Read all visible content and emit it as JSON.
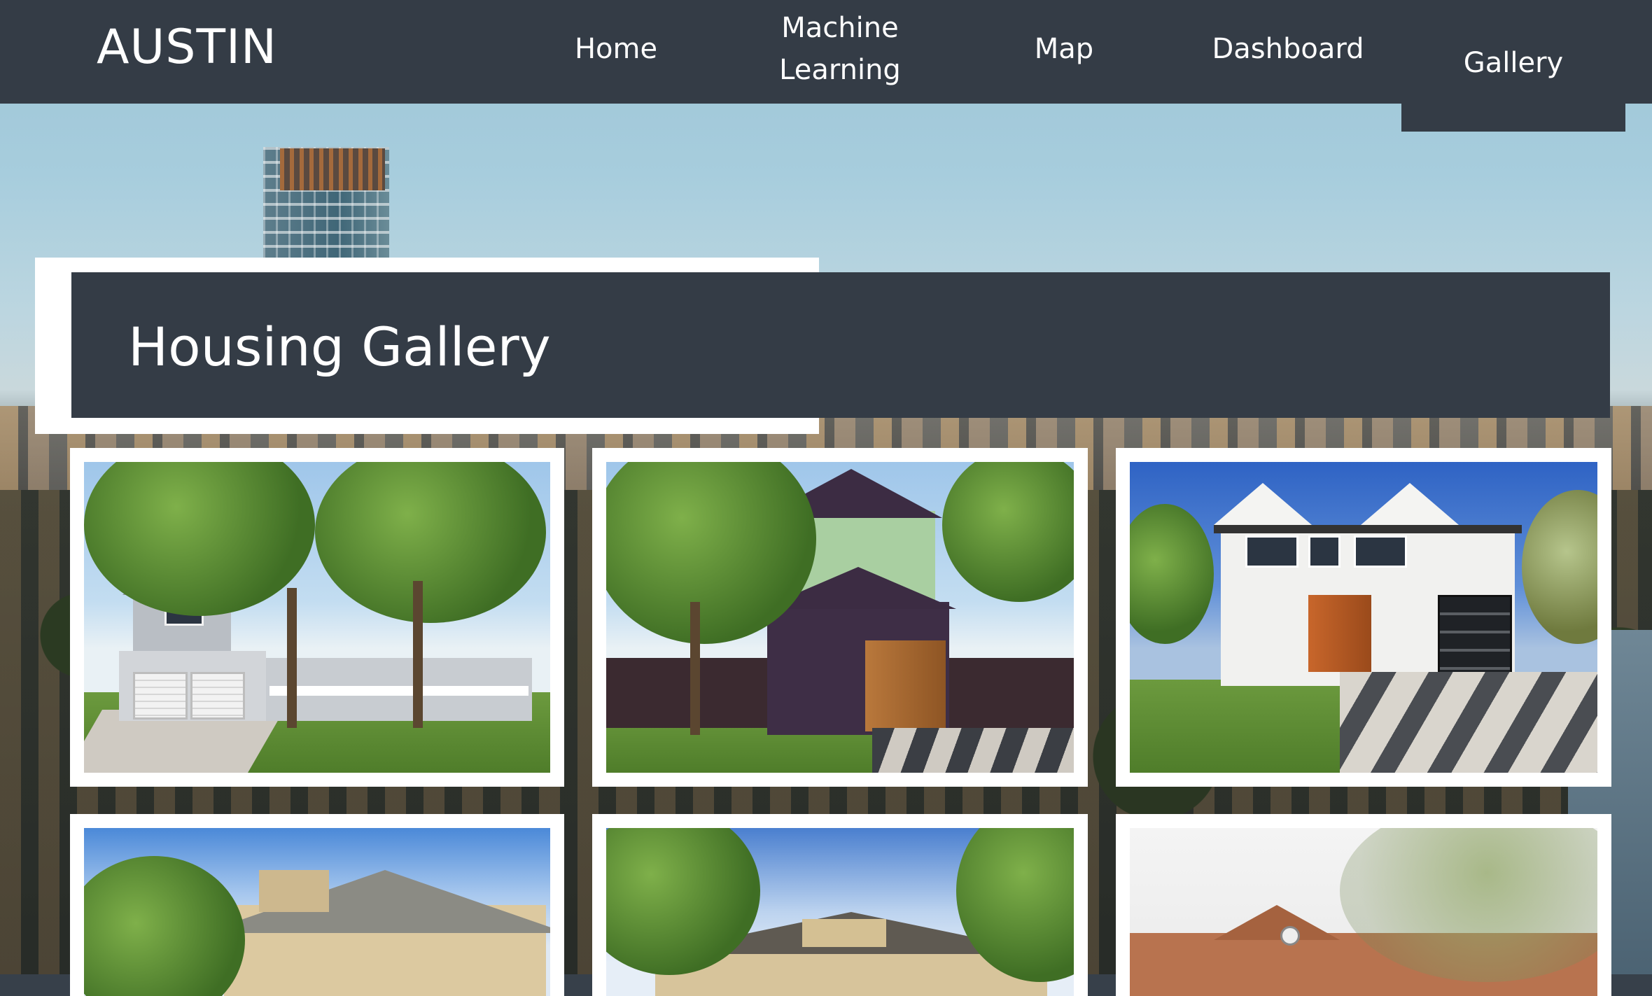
{
  "nav": {
    "brand": "AUSTIN",
    "items": {
      "home": "Home",
      "ml_line1": "Machine",
      "ml_line2": "Learning",
      "map": "Map",
      "dashboard": "Dashboard",
      "gallery": "Gallery"
    },
    "active": "Gallery"
  },
  "page": {
    "title": "Housing Gallery"
  },
  "colors": {
    "nav_bg": "#343c46",
    "panel_bg": "#343c46",
    "card_frame": "#ffffff",
    "text": "#ffffff"
  },
  "gallery": {
    "cards": [
      {
        "subject": "two-story gray house with white garage doors and large trees"
      },
      {
        "subject": "purple and green two-story house with wooden garage door"
      },
      {
        "subject": "white modern farmhouse with wood and glass garage doors"
      },
      {
        "subject": "beige house with gray roof under blue sky"
      },
      {
        "subject": "tan single-story house among trees"
      },
      {
        "subject": "brick house with round attic window behind bare tree"
      }
    ]
  }
}
